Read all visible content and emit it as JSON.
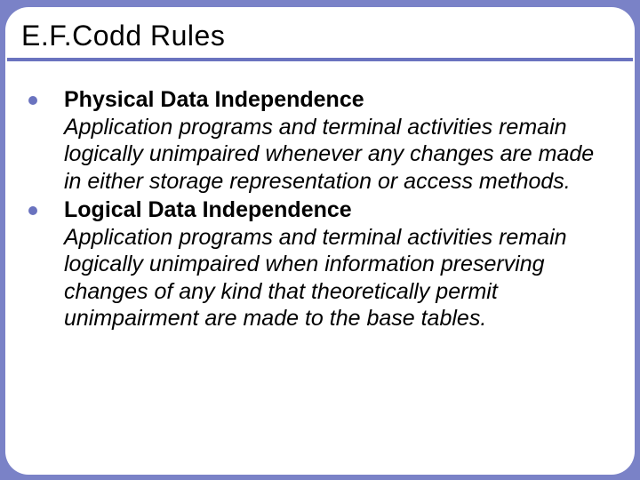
{
  "slide": {
    "title": "E.F.Codd Rules",
    "rules": [
      {
        "heading": "Physical Data Independence",
        "description": "Application programs and terminal activities remain logically unimpaired whenever any changes are made in either storage representation or access methods."
      },
      {
        "heading": "Logical Data Independence",
        "description": "Application programs and terminal activities remain logically unimpaired when information preserving changes of any kind that theoretically permit unimpairment are made to the base tables."
      }
    ]
  }
}
